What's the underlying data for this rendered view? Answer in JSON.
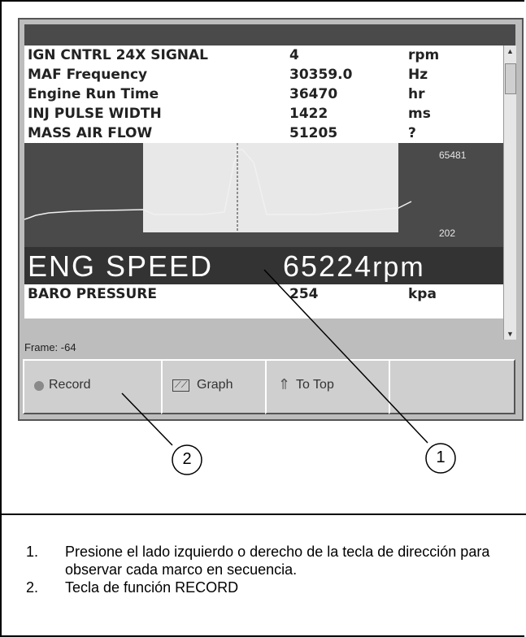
{
  "params": [
    {
      "name": "IGN CNTRL 24X SIGNAL",
      "value": "4",
      "unit": "rpm"
    },
    {
      "name": "MAF Frequency",
      "value": "30359.0",
      "unit": "Hz"
    },
    {
      "name": "Engine Run Time",
      "value": "36470",
      "unit": "hr"
    },
    {
      "name": "INJ PULSE WIDTH",
      "value": "1422",
      "unit": "ms"
    },
    {
      "name": "MASS AIR FLOW",
      "value": "51205",
      "unit": "?"
    }
  ],
  "graph": {
    "max_label": "65481",
    "min_label": "202"
  },
  "highlight": {
    "name": "ENG SPEED",
    "value": "65224",
    "unit": "rpm"
  },
  "next_param": {
    "name": "BARO PRESSURE",
    "value": "254",
    "unit": "kpa"
  },
  "frame_label": "Frame: -64",
  "function_keys": [
    {
      "label": "Record",
      "icon": "record-dot-icon"
    },
    {
      "label": "Graph",
      "icon": "graph-icon"
    },
    {
      "label": "To Top",
      "icon": "up-arrow-icon"
    },
    {
      "label": ""
    }
  ],
  "callouts": [
    "1",
    "2"
  ],
  "notes": [
    {
      "num": "1.",
      "text": "Presione el lado izquierdo o derecho de la tecla de dirección para observar cada marco en secuencia."
    },
    {
      "num": "2.",
      "text": "Tecla de función RECORD"
    }
  ]
}
